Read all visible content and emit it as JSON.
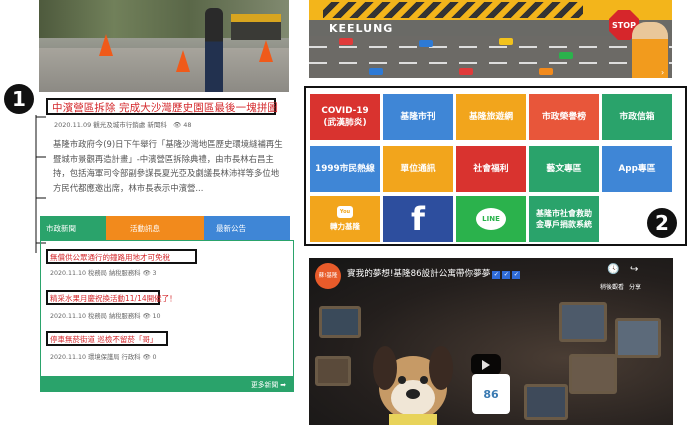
{
  "left": {
    "headline": "中濱營區拆除 完成大沙灣歷史園區最後一塊拼圖",
    "meta": "2020.11.09  觀光及城市行銷處 新聞科",
    "views": "48",
    "summary": "基隆市政府今(9)日下午舉行「基隆沙灣地區歷史環境縫補再生暨城市景觀再造計畫」-中濱營區拆除典禮，由市長林右昌主持，包括海軍司令部副參謀長夏光亞及劇議長林沛祥等多位地方民代都應邀出席，林市長表示中濱營...",
    "tabs": [
      {
        "label": "市政新聞",
        "color": "#2aa36b"
      },
      {
        "label": "活動訊息",
        "color": "#f28a1c"
      },
      {
        "label": "最新公告",
        "color": "#3f86d6"
      }
    ],
    "news": [
      {
        "title": "無償供公眾通行的鐘路用地才可免稅",
        "meta": "2020.11.10  稅務局 納稅服務科",
        "views": "3"
      },
      {
        "title": "精采水果月慶祝換活動11/14開催了！",
        "meta": "2020.11.10  稅務局 納稅服務科",
        "views": "10"
      },
      {
        "title": "停車無菸街道 巡檢不留菸「哥」",
        "meta": "2020.11.10  環境保護局 行政科",
        "views": "0"
      }
    ],
    "more": "更多新聞 ➡",
    "marker": "1"
  },
  "right": {
    "banner_title": "KEELUNG",
    "banner_stop": "STOP",
    "marker": "2",
    "tiles": [
      {
        "label": "COVID-19",
        "sub": "(武漢肺炎)",
        "color": "#d9332f"
      },
      {
        "label": "基隆市刊",
        "sub": "",
        "color": "#3f86d6"
      },
      {
        "label": "基隆旅遊網",
        "sub": "",
        "color": "#f2a51c"
      },
      {
        "label": "市政榮譽榜",
        "sub": "",
        "color": "#e8563a"
      },
      {
        "label": "市政信箱",
        "sub": "",
        "color": "#2aa36b"
      },
      {
        "label": "1999市民熱線",
        "sub": "",
        "color": "#3f86d6"
      },
      {
        "label": "單位通訊",
        "sub": "",
        "color": "#f2a51c"
      },
      {
        "label": "社會福利",
        "sub": "",
        "color": "#d9332f"
      },
      {
        "label": "藝文專區",
        "sub": "",
        "color": "#2aa36b"
      },
      {
        "label": "App專區",
        "sub": "",
        "color": "#3f86d6"
      },
      {
        "label": "轉力基隆",
        "sub": "",
        "color": "#f2a51c"
      },
      {
        "label": "f",
        "sub": "",
        "color": "#2d4e9e"
      },
      {
        "label": "LINE",
        "sub": "",
        "color": "#2bb24c"
      },
      {
        "label": "基隆市社會救助金專戶捐款系統",
        "sub": "",
        "color": "#2aa36b"
      }
    ],
    "video": {
      "channel": "蘇!基隆",
      "title": "實我的夢想!基隆86設計公寓帶你夢夢",
      "watch_later": "稍後觀看",
      "share": "分享",
      "house_text": "86"
    }
  },
  "icons": [
    "eye-icon",
    "youtube-icon",
    "facebook-icon",
    "line-icon",
    "play-icon",
    "clock-icon",
    "share-icon",
    "check-badge-icon"
  ]
}
